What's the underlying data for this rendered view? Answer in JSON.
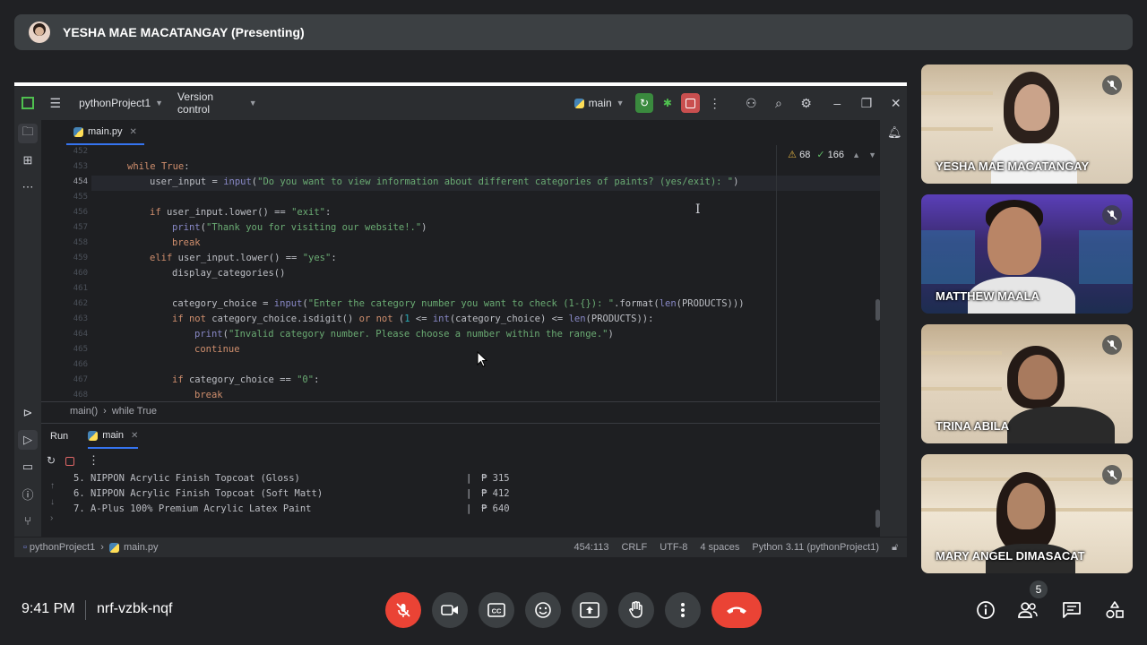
{
  "meet": {
    "presenter_label": "YESHA MAE MACATANGAY (Presenting)",
    "time": "9:41 PM",
    "meeting_code": "nrf-vzbk-nqf",
    "people_count": "5",
    "participants": [
      {
        "name": "YESHA MAE MACATANGAY"
      },
      {
        "name": "MATTHEW MAALA"
      },
      {
        "name": "TRINA ABILA"
      },
      {
        "name": "MARY ANGEL DIMASACAT"
      }
    ]
  },
  "ide": {
    "project": "pythonProject1",
    "version_control": "Version control",
    "branch": "main",
    "tab": "main.py",
    "warnings": "68",
    "checks": "166",
    "breadcrumb_1": "main()",
    "breadcrumb_2": "while True",
    "run_label": "Run",
    "run_config": "main",
    "status": {
      "path_project": "pythonProject1",
      "path_file": "main.py",
      "position": "454:113",
      "line_sep": "CRLF",
      "encoding": "UTF-8",
      "indent": "4 spaces",
      "interpreter": "Python 3.11 (pythonProject1)"
    },
    "line_numbers": [
      "452",
      "453",
      "454",
      "455",
      "456",
      "457",
      "458",
      "459",
      "460",
      "461",
      "462",
      "463",
      "464",
      "465",
      "466",
      "467",
      "468"
    ],
    "output": [
      {
        "item": "5. NIPPON Acrylic Finish Topcoat (Gloss)",
        "sep": "|",
        "price": "₱ 315"
      },
      {
        "item": "6. NIPPON Acrylic Finish Topcoat (Soft Matt)",
        "sep": "|",
        "price": "₱ 412"
      },
      {
        "item": "7. A-Plus 100% Premium Acrylic Latex Paint",
        "sep": "|",
        "price": "₱ 640"
      }
    ]
  }
}
